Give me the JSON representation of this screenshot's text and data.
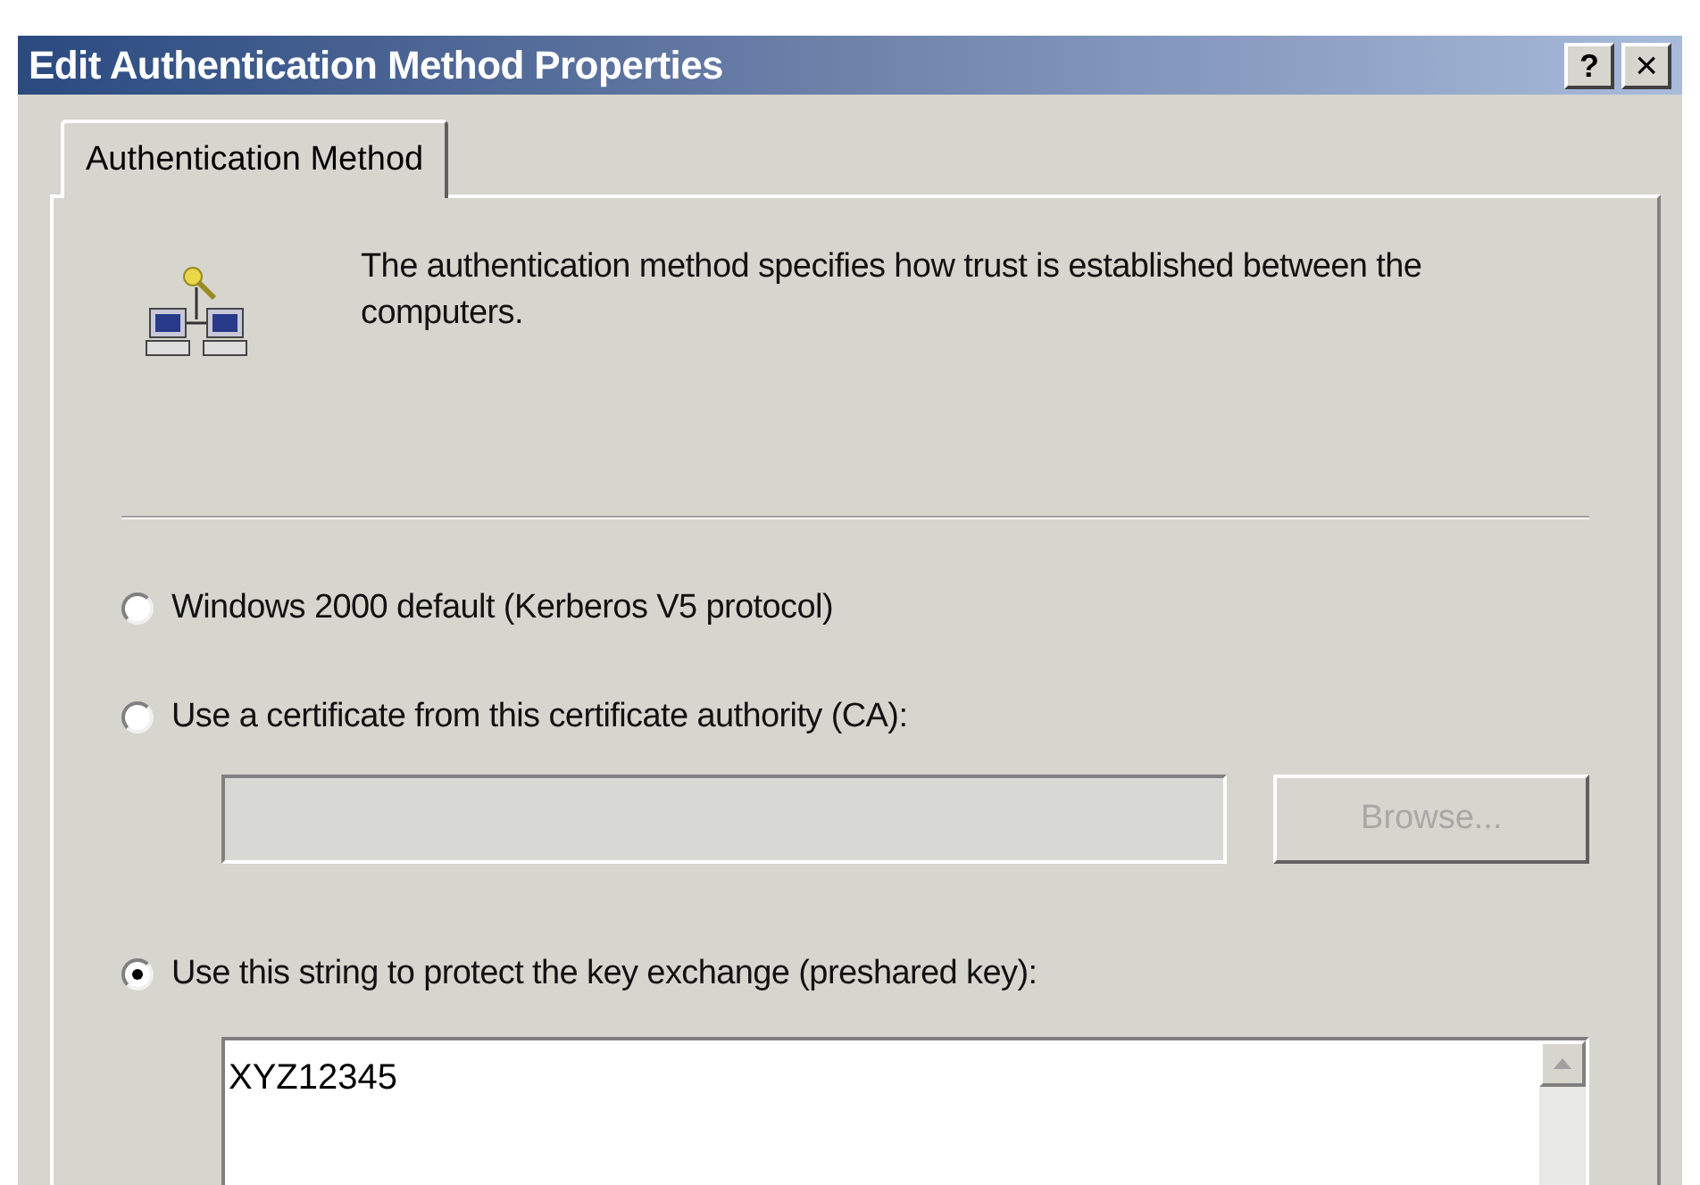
{
  "window": {
    "title": "Edit Authentication Method Properties",
    "help_button": "?",
    "close_button": "×"
  },
  "tabs": [
    {
      "label": "Authentication Method",
      "selected": true
    }
  ],
  "description": "The authentication method specifies how trust is established between the computers.",
  "options": [
    {
      "label": "Windows 2000 default (Kerberos V5 protocol)",
      "selected": false
    },
    {
      "label": "Use a certificate from this certificate authority (CA):",
      "selected": false
    },
    {
      "label": "Use this string to protect the key exchange (preshared key):",
      "selected": true
    }
  ],
  "certificate_field": {
    "disabled": true
  },
  "browse_button": {
    "label": "Browse...",
    "disabled": true
  },
  "preshared_key": {
    "value": "XYZ12345"
  }
}
